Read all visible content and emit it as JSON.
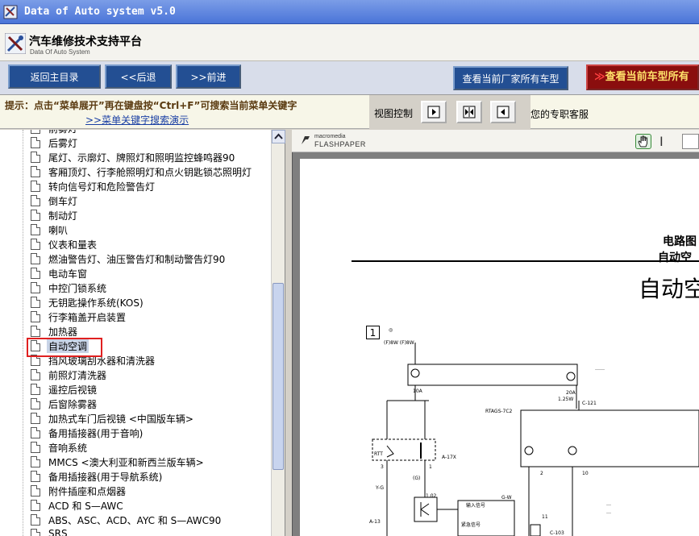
{
  "window": {
    "title": "Data of Auto system v5.0"
  },
  "header": {
    "title": "汽车维修技术支持平台",
    "subtitle": "Data Of Auto System"
  },
  "toolbar": {
    "home": "返回主目录",
    "back": "<<后退",
    "forward": ">>前进",
    "all_models_maker": "查看当前厂家所有车型",
    "all_models_current": "查看当前车型所有"
  },
  "hint": {
    "text": "提示：点击“菜单展开”再在键盘按“Ctrl+F”可搜索当前菜单关键字",
    "link": ">>菜单关键字搜索演示"
  },
  "view_control": {
    "label": "视图控制"
  },
  "support": "您的专职客服",
  "tree": {
    "items": [
      {
        "label": "前雾灯"
      },
      {
        "label": "后雾灯"
      },
      {
        "label": "尾灯、示廓灯、牌照灯和照明监控蜂鸣器90"
      },
      {
        "label": "客厢顶灯、行李舱照明灯和点火钥匙锁芯照明灯"
      },
      {
        "label": "转向信号灯和危险警告灯"
      },
      {
        "label": "倒车灯"
      },
      {
        "label": "制动灯"
      },
      {
        "label": "喇叭"
      },
      {
        "label": "仪表和量表"
      },
      {
        "label": "燃油警告灯、油压警告灯和制动警告灯90"
      },
      {
        "label": "电动车窗"
      },
      {
        "label": "中控门锁系统"
      },
      {
        "label": "无钥匙操作系统(KOS)"
      },
      {
        "label": "行李箱盖开启装置"
      },
      {
        "label": "加热器"
      },
      {
        "label": "自动空调"
      },
      {
        "label": "挡风玻璃刮水器和清洗器"
      },
      {
        "label": "前照灯清洗器"
      },
      {
        "label": "遥控后视镜"
      },
      {
        "label": "后窗除雾器"
      },
      {
        "label": "加热式车门后视镜 <中国版车辆>"
      },
      {
        "label": "备用插接器(用于音响)"
      },
      {
        "label": "音响系统"
      },
      {
        "label": "MMCS <澳大利亚和新西兰版车辆>"
      },
      {
        "label": "备用插接器(用于导航系统)"
      },
      {
        "label": "附件插座和点烟器"
      },
      {
        "label": "ACD 和 S—AWC"
      },
      {
        "label": "ABS、ASC、ACD、AYC 和 S—AWC90"
      },
      {
        "label": "SRS"
      }
    ],
    "selected_index": 15
  },
  "viewer": {
    "brand_top": "macromedia",
    "brand_bottom": "FLASHPAPER",
    "page": {
      "heading1": "电路图",
      "heading2": "自动空",
      "big_title": "自动空",
      "section_no": "1"
    }
  }
}
